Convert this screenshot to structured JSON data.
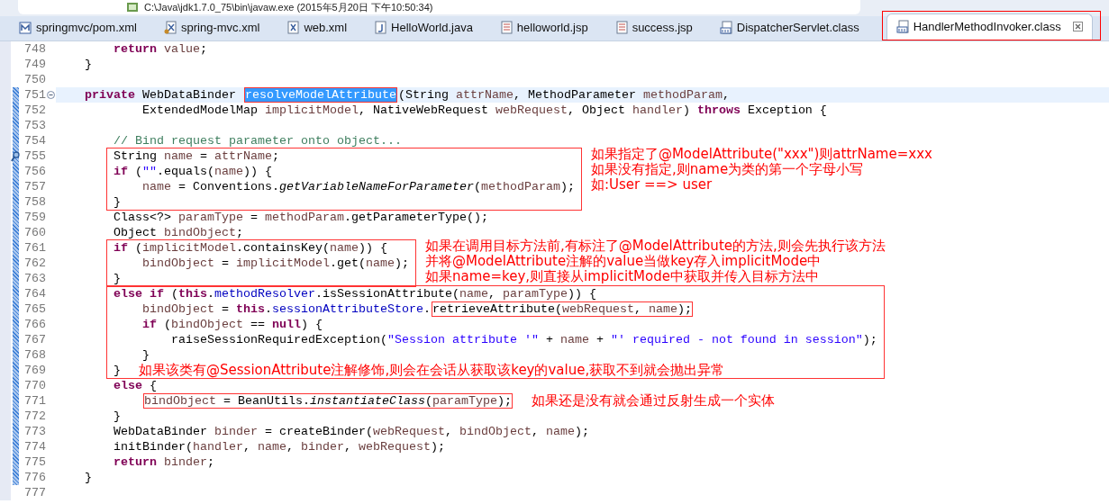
{
  "console_title": "C:\\Java\\jdk1.7.0_75\\bin\\javaw.exe (2015年5月20日 下午10:50:34)",
  "tabs": [
    {
      "label": "springmvc/pom.xml",
      "kind": "maven",
      "selected": false,
      "annotated": false
    },
    {
      "label": "spring-mvc.xml",
      "kind": "xml-config",
      "selected": false,
      "annotated": false
    },
    {
      "label": "web.xml",
      "kind": "xml",
      "selected": false,
      "annotated": false
    },
    {
      "label": "HelloWorld.java",
      "kind": "java",
      "selected": false,
      "annotated": false
    },
    {
      "label": "helloworld.jsp",
      "kind": "jsp",
      "selected": false,
      "annotated": false
    },
    {
      "label": "success.jsp",
      "kind": "jsp",
      "selected": false,
      "annotated": false
    },
    {
      "label": "DispatcherServlet.class",
      "kind": "class",
      "selected": false,
      "annotated": false
    },
    {
      "label": "HandlerMethodInvoker.class",
      "kind": "class",
      "selected": true,
      "annotated": true
    }
  ],
  "lines": [
    {
      "kind": "line",
      "number": "748",
      "in_range": false,
      "current": false,
      "tokens": [
        {
          "t": "        return",
          "kind": "kw"
        },
        {
          "t": " value",
          "kind": "v"
        },
        {
          "t": ";",
          "kind": "p"
        }
      ]
    },
    {
      "kind": "line",
      "number": "749",
      "in_range": false,
      "current": false,
      "tokens": [
        {
          "t": "    }",
          "kind": "p"
        }
      ]
    },
    {
      "kind": "line",
      "number": "750",
      "in_range": false,
      "current": false
    },
    {
      "kind": "line",
      "number": "751",
      "in_range": true,
      "current": true,
      "gutter_mark": {
        "kind": "fold"
      },
      "tokens": [
        {
          "t": "    private",
          "kind": "kw"
        },
        {
          "t": " WebDataBinder ",
          "kind": "p"
        },
        {
          "kind": "box",
          "tokens": [
            {
              "t": "resolveModelAttribute",
              "kind": "sel"
            }
          ]
        },
        {
          "t": "(String ",
          "kind": "p"
        },
        {
          "t": "attrName",
          "kind": "v"
        },
        {
          "t": ", MethodParameter ",
          "kind": "p"
        },
        {
          "t": "methodParam",
          "kind": "v"
        },
        {
          "t": ",",
          "kind": "p"
        }
      ]
    },
    {
      "kind": "line",
      "number": "752",
      "in_range": true,
      "current": false,
      "tokens": [
        {
          "t": "            ExtendedModelMap ",
          "kind": "p"
        },
        {
          "t": "implicitModel",
          "kind": "v"
        },
        {
          "t": ", NativeWebRequest ",
          "kind": "p"
        },
        {
          "t": "webRequest",
          "kind": "v"
        },
        {
          "t": ", Object ",
          "kind": "p"
        },
        {
          "t": "handler",
          "kind": "v"
        },
        {
          "t": ") ",
          "kind": "p"
        },
        {
          "t": "throws",
          "kind": "kw"
        },
        {
          "t": " Exception {",
          "kind": "p"
        }
      ]
    },
    {
      "kind": "line",
      "number": "753",
      "in_range": true,
      "current": false
    },
    {
      "kind": "line",
      "number": "754",
      "in_range": true,
      "current": false,
      "tokens": [
        {
          "t": "        // Bind request parameter onto object...",
          "kind": "c"
        }
      ]
    },
    {
      "kind": "boxed_group",
      "note": [
        "如果指定了@ModelAttribute(\"xxx\")则attrName=xxx",
        "如果没有指定,则name为类的第一个字母小写",
        "如:User ==> user"
      ],
      "lines": [
        {
          "kind": "line",
          "number": "755",
          "in_range": true,
          "current": false,
          "gutter_mark": {
            "kind": "bookmark"
          },
          "tokens": [
            {
              "t": "        String ",
              "kind": "p"
            },
            {
              "t": "name",
              "kind": "v"
            },
            {
              "t": " = ",
              "kind": "p"
            },
            {
              "t": "attrName",
              "kind": "v"
            },
            {
              "t": ";",
              "kind": "p"
            }
          ]
        },
        {
          "kind": "line",
          "number": "756",
          "in_range": true,
          "current": false,
          "tokens": [
            {
              "t": "        if",
              "kind": "kw"
            },
            {
              "t": " (",
              "kind": "p"
            },
            {
              "t": "\"\"",
              "kind": "s"
            },
            {
              "t": ".equals(",
              "kind": "p"
            },
            {
              "t": "name",
              "kind": "v"
            },
            {
              "t": ")) {",
              "kind": "p"
            }
          ]
        },
        {
          "kind": "line",
          "number": "757",
          "in_range": true,
          "current": false,
          "tokens": [
            {
              "t": "            name",
              "kind": "v"
            },
            {
              "t": " = Conventions.",
              "kind": "p"
            },
            {
              "t": "getVariableNameForParameter",
              "kind": "i"
            },
            {
              "t": "(",
              "kind": "p"
            },
            {
              "t": "methodParam",
              "kind": "v"
            },
            {
              "t": ");",
              "kind": "p"
            }
          ]
        },
        {
          "kind": "line",
          "number": "758",
          "in_range": true,
          "current": false,
          "tokens": [
            {
              "t": "        }",
              "kind": "p"
            }
          ]
        }
      ]
    },
    {
      "kind": "line",
      "number": "759",
      "in_range": true,
      "current": false,
      "tokens": [
        {
          "t": "        Class<?> ",
          "kind": "p"
        },
        {
          "t": "paramType",
          "kind": "v"
        },
        {
          "t": " = ",
          "kind": "p"
        },
        {
          "t": "methodParam",
          "kind": "v"
        },
        {
          "t": ".getParameterType();",
          "kind": "p"
        }
      ]
    },
    {
      "kind": "line",
      "number": "760",
      "in_range": true,
      "current": false,
      "tokens": [
        {
          "t": "        Object ",
          "kind": "p"
        },
        {
          "t": "bindObject",
          "kind": "v"
        },
        {
          "t": ";",
          "kind": "p"
        }
      ]
    },
    {
      "kind": "boxed_group",
      "note": [
        "如果在调用目标方法前,有标注了@ModelAttribute的方法,则会先执行该方法",
        "并将@ModelAttribute注解的value当做key存入implicitMode中",
        "如果name=key,则直接从implicitMode中获取并传入目标方法中"
      ],
      "lines": [
        {
          "kind": "line",
          "number": "761",
          "in_range": true,
          "current": false,
          "tokens": [
            {
              "t": "        if",
              "kind": "kw"
            },
            {
              "t": " (",
              "kind": "p"
            },
            {
              "t": "implicitModel",
              "kind": "v"
            },
            {
              "t": ".containsKey(",
              "kind": "p"
            },
            {
              "t": "name",
              "kind": "v"
            },
            {
              "t": ")) {",
              "kind": "p"
            }
          ]
        },
        {
          "kind": "line",
          "number": "762",
          "in_range": true,
          "current": false,
          "tokens": [
            {
              "t": "            bindObject",
              "kind": "v"
            },
            {
              "t": " = ",
              "kind": "p"
            },
            {
              "t": "implicitModel",
              "kind": "v"
            },
            {
              "t": ".get(",
              "kind": "p"
            },
            {
              "t": "name",
              "kind": "v"
            },
            {
              "t": ");",
              "kind": "p"
            }
          ]
        },
        {
          "kind": "line",
          "number": "763",
          "in_range": true,
          "current": false,
          "tokens": [
            {
              "t": "        }",
              "kind": "p"
            }
          ]
        }
      ]
    },
    {
      "kind": "boxed_group",
      "lines": [
        {
          "kind": "line",
          "number": "764",
          "in_range": true,
          "current": false,
          "tokens": [
            {
              "t": "        else",
              "kind": "kw"
            },
            {
              "t": " if",
              "kind": "kw"
            },
            {
              "t": " (",
              "kind": "p"
            },
            {
              "t": "this",
              "kind": "kw"
            },
            {
              "t": ".",
              "kind": "p"
            },
            {
              "t": "methodResolver",
              "kind": "f"
            },
            {
              "t": ".isSessionAttribute(",
              "kind": "p"
            },
            {
              "t": "name",
              "kind": "v"
            },
            {
              "t": ", ",
              "kind": "p"
            },
            {
              "t": "paramType",
              "kind": "v"
            },
            {
              "t": ")) {",
              "kind": "p"
            }
          ]
        },
        {
          "kind": "line",
          "number": "765",
          "in_range": true,
          "current": false,
          "tokens": [
            {
              "t": "            bindObject",
              "kind": "v"
            },
            {
              "t": " = ",
              "kind": "p"
            },
            {
              "t": "this",
              "kind": "kw"
            },
            {
              "t": ".",
              "kind": "p"
            },
            {
              "t": "sessionAttributeStore",
              "kind": "f"
            },
            {
              "t": ".",
              "kind": "p"
            },
            {
              "kind": "box",
              "tokens": [
                {
                  "t": "retrieveAttribute(",
                  "kind": "p"
                },
                {
                  "t": "webRequest",
                  "kind": "v"
                },
                {
                  "t": ", ",
                  "kind": "p"
                },
                {
                  "t": "name",
                  "kind": "v"
                },
                {
                  "t": ");",
                  "kind": "p"
                }
              ]
            }
          ]
        },
        {
          "kind": "line",
          "number": "766",
          "in_range": true,
          "current": false,
          "tokens": [
            {
              "t": "            if",
              "kind": "kw"
            },
            {
              "t": " (",
              "kind": "p"
            },
            {
              "t": "bindObject",
              "kind": "v"
            },
            {
              "t": " == ",
              "kind": "p"
            },
            {
              "t": "null",
              "kind": "kw"
            },
            {
              "t": ") {",
              "kind": "p"
            }
          ]
        },
        {
          "kind": "line",
          "number": "767",
          "in_range": true,
          "current": false,
          "tokens": [
            {
              "t": "                raiseSessionRequiredException(",
              "kind": "p"
            },
            {
              "t": "\"Session attribute '\"",
              "kind": "s"
            },
            {
              "t": " + ",
              "kind": "p"
            },
            {
              "t": "name",
              "kind": "v"
            },
            {
              "t": " + ",
              "kind": "p"
            },
            {
              "t": "\"' required - not found in session\"",
              "kind": "s"
            },
            {
              "t": ");",
              "kind": "p"
            }
          ]
        },
        {
          "kind": "line",
          "number": "768",
          "in_range": true,
          "current": false,
          "tokens": [
            {
              "t": "            }",
              "kind": "p"
            }
          ]
        },
        {
          "kind": "line",
          "number": "769",
          "in_range": true,
          "current": false,
          "tokens": [
            {
              "t": "        }",
              "kind": "p"
            }
          ],
          "note": "如果该类有@SessionAttribute注解修饰,则会在会话从获取该key的value,获取不到就会抛出异常"
        }
      ]
    },
    {
      "kind": "line",
      "number": "770",
      "in_range": true,
      "current": false,
      "tokens": [
        {
          "t": "        else",
          "kind": "kw"
        },
        {
          "t": " {",
          "kind": "p"
        }
      ]
    },
    {
      "kind": "line",
      "number": "771",
      "in_range": true,
      "current": false,
      "tokens": [
        {
          "kind": "box",
          "tokens": [
            {
              "t": "            bindObject",
              "kind": "v"
            },
            {
              "t": " = BeanUtils.",
              "kind": "p"
            },
            {
              "t": "instantiateClass",
              "kind": "i"
            },
            {
              "t": "(",
              "kind": "p"
            },
            {
              "t": "paramType",
              "kind": "v"
            },
            {
              "t": ");",
              "kind": "p"
            }
          ]
        }
      ],
      "note": "如果还是没有就会通过反射生成一个实体"
    },
    {
      "kind": "line",
      "number": "772",
      "in_range": true,
      "current": false,
      "tokens": [
        {
          "t": "        }",
          "kind": "p"
        }
      ]
    },
    {
      "kind": "line",
      "number": "773",
      "in_range": true,
      "current": false,
      "tokens": [
        {
          "t": "        WebDataBinder ",
          "kind": "p"
        },
        {
          "t": "binder",
          "kind": "v"
        },
        {
          "t": " = createBinder(",
          "kind": "p"
        },
        {
          "t": "webRequest",
          "kind": "v"
        },
        {
          "t": ", ",
          "kind": "p"
        },
        {
          "t": "bindObject",
          "kind": "v"
        },
        {
          "t": ", ",
          "kind": "p"
        },
        {
          "t": "name",
          "kind": "v"
        },
        {
          "t": ");",
          "kind": "p"
        }
      ]
    },
    {
      "kind": "line",
      "number": "774",
      "in_range": true,
      "current": false,
      "tokens": [
        {
          "t": "        initBinder(",
          "kind": "p"
        },
        {
          "t": "handler",
          "kind": "v"
        },
        {
          "t": ", ",
          "kind": "p"
        },
        {
          "t": "name",
          "kind": "v"
        },
        {
          "t": ", ",
          "kind": "p"
        },
        {
          "t": "binder",
          "kind": "v"
        },
        {
          "t": ", ",
          "kind": "p"
        },
        {
          "t": "webRequest",
          "kind": "v"
        },
        {
          "t": ");",
          "kind": "p"
        }
      ]
    },
    {
      "kind": "line",
      "number": "775",
      "in_range": true,
      "current": false,
      "tokens": [
        {
          "t": "        return",
          "kind": "kw"
        },
        {
          "t": " binder",
          "kind": "v"
        },
        {
          "t": ";",
          "kind": "p"
        }
      ]
    },
    {
      "kind": "line",
      "number": "776",
      "in_range": true,
      "current": false,
      "tokens": [
        {
          "t": "    }",
          "kind": "p"
        }
      ]
    },
    {
      "kind": "line",
      "number": "777",
      "in_range": false,
      "current": false
    }
  ]
}
